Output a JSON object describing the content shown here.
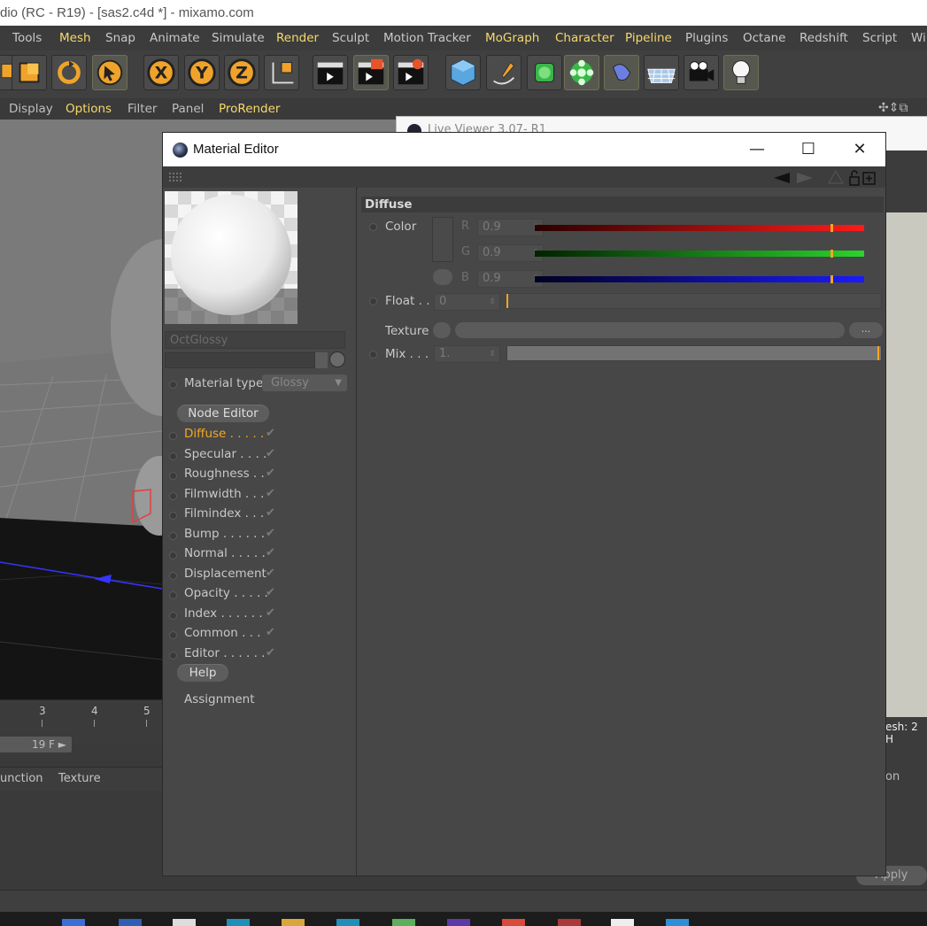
{
  "window_title": "dio (RC - R19) - [sas2.c4d *] - mixamo.com",
  "menubar": {
    "items": [
      {
        "label": "Tools",
        "hl": false
      },
      {
        "label": "Mesh",
        "hl": true
      },
      {
        "label": "Snap",
        "hl": false
      },
      {
        "label": "Animate",
        "hl": false
      },
      {
        "label": "Simulate",
        "hl": false
      },
      {
        "label": "Render",
        "hl": true
      },
      {
        "label": "Sculpt",
        "hl": false
      },
      {
        "label": "Motion Tracker",
        "hl": false
      },
      {
        "label": "MoGraph",
        "hl": true
      },
      {
        "label": "Character",
        "hl": true
      },
      {
        "label": "Pipeline",
        "hl": true
      },
      {
        "label": "Plugins",
        "hl": false
      },
      {
        "label": "Octane",
        "hl": false
      },
      {
        "label": "Redshift",
        "hl": false
      },
      {
        "label": "Script",
        "hl": false
      },
      {
        "label": "Wi",
        "hl": false
      }
    ]
  },
  "toolbar": {
    "axis_x": "X",
    "axis_y": "Y",
    "axis_z": "Z"
  },
  "viewport_menu": {
    "items": [
      {
        "label": "Display",
        "hl": false
      },
      {
        "label": "Options",
        "hl": true
      },
      {
        "label": "Filter",
        "hl": false
      },
      {
        "label": "Panel",
        "hl": false
      },
      {
        "label": "ProRender",
        "hl": true
      }
    ]
  },
  "timeline": {
    "ticks": [
      "3",
      "4",
      "5"
    ],
    "frame": "19 F ►"
  },
  "material_manager": {
    "col1": "unction",
    "col2": "Texture"
  },
  "live_viewer_title": "Live Viewer 3.07- R1",
  "right_panel": {
    "mesh_text": "esh: 2  H",
    "on_text": "on",
    "apply_label": "Apply"
  },
  "material_editor": {
    "title": "Material Editor",
    "minimize": "—",
    "maximize": "☐",
    "close": "✕",
    "material_name": "OctGlossy",
    "material_type_label": "Material type",
    "material_type_value": "Glossy",
    "node_editor_label": "Node Editor",
    "help_label": "Help",
    "assignment_label": "Assignment",
    "channels": [
      {
        "label": "Diffuse . . . . .",
        "active": true
      },
      {
        "label": "Specular . . . .",
        "active": false
      },
      {
        "label": "Roughness . .",
        "active": false
      },
      {
        "label": "Filmwidth . . .",
        "active": false
      },
      {
        "label": "Filmindex . . .",
        "active": false
      },
      {
        "label": "Bump . . . . . .",
        "active": false
      },
      {
        "label": "Normal . . . . .",
        "active": false
      },
      {
        "label": "Displacement",
        "active": false
      },
      {
        "label": "Opacity . . . . .",
        "active": false
      },
      {
        "label": "Index . . . . . .",
        "active": false
      },
      {
        "label": "Common . . .",
        "active": false
      },
      {
        "label": "Editor . . . . . .",
        "active": false
      }
    ],
    "check_glyph": "✔",
    "diffuse": {
      "header": "Diffuse",
      "color_label": "Color",
      "r_label": "R",
      "r_value": "0.9",
      "r_level": 0.9,
      "g_label": "G",
      "g_value": "0.9",
      "g_level": 0.9,
      "b_label": "B",
      "b_value": "0.9",
      "b_level": 0.9,
      "float_label": "Float . .",
      "float_value": "0",
      "texture_label": "Texture",
      "texture_more": "...",
      "mix_label": "Mix . . .",
      "mix_value": "1."
    }
  },
  "colors": {
    "accent_yellow": "#f6d96b",
    "active_channel": "#f5a623",
    "red_bar": "#ff1a1a",
    "green_bar": "#2ad42a",
    "blue_bar": "#1a1aff"
  }
}
